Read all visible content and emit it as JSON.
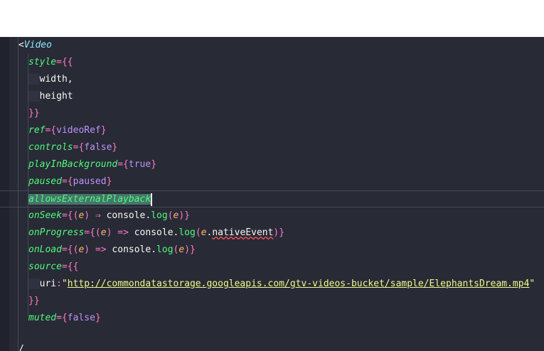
{
  "code": {
    "l1_open": "<",
    "l1_tag": "Video",
    "l2_attr": "style",
    "l2_rest": "={{",
    "l3": "width,",
    "l4": "height",
    "l5": "}}",
    "l6_attr": "ref",
    "l6_val": "videoRef",
    "l7_attr": "controls",
    "l7_val": "false",
    "l8_attr": "playInBackground",
    "l8_val": "true",
    "l9_attr": "paused",
    "l9_val": "paused",
    "l10_attr": "allowsExternalPlayback",
    "l11_attr": "onSeek",
    "l11_param": "e",
    "l11_arrow": "⇒",
    "l11_obj": "console",
    "l11_fn": "log",
    "l11_arg": "e",
    "l12_attr": "onProgress",
    "l12_param": "e",
    "l12_arrow": "=>",
    "l12_obj": "console",
    "l12_fn": "log",
    "l12_arg": "e",
    "l12_prop": "nativeEvent",
    "l13_attr": "onLoad",
    "l13_param": "e",
    "l13_arrow": "=>",
    "l13_obj": "console",
    "l13_fn": "log",
    "l13_arg": "e",
    "l14_attr": "source",
    "l14_rest": "={{",
    "l15_key": "uri",
    "l15_url": "http://commondatastorage.googleapis.com/gtv-videos-bucket/sample/ElephantsDream.mp4",
    "l16": "}}",
    "l17_attr": "muted",
    "l17_val": "false",
    "l19": "/"
  },
  "colors": {
    "background": "#282a36",
    "attribute": "#50fa7b",
    "keyword": "#bd93f9",
    "string": "#f1fa8c",
    "parameter": "#ffb86c",
    "error_squiggle": "#ff5555"
  }
}
